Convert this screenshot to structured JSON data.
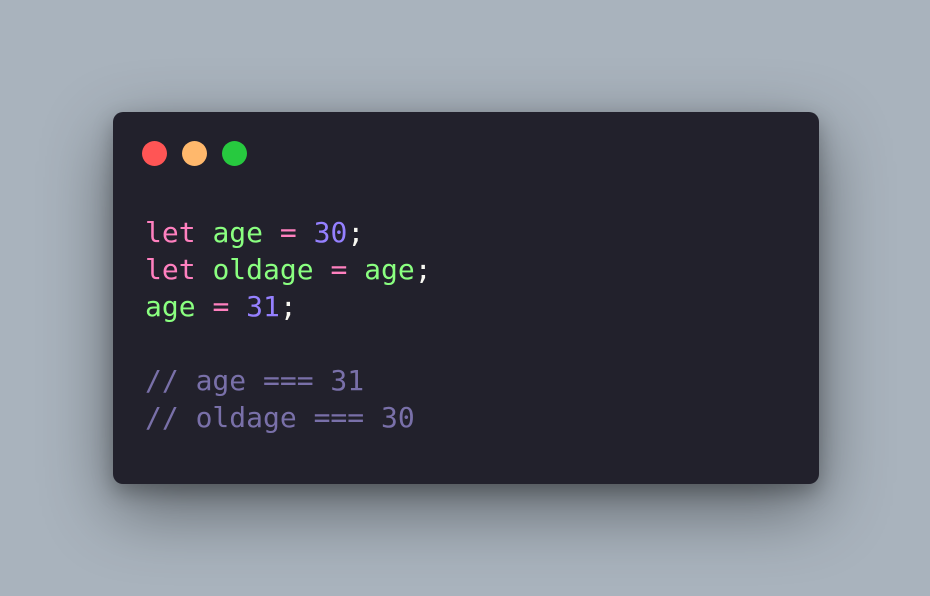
{
  "window": {
    "controls": [
      {
        "name": "close",
        "color": "#ff5555"
      },
      {
        "name": "minimize",
        "color": "#ffb86c"
      },
      {
        "name": "maximize",
        "color": "#27c93f"
      }
    ]
  },
  "code": {
    "lines": [
      [
        {
          "t": "let",
          "c": "kw"
        },
        {
          "t": " "
        },
        {
          "t": "age",
          "c": "var"
        },
        {
          "t": " "
        },
        {
          "t": "=",
          "c": "op"
        },
        {
          "t": " "
        },
        {
          "t": "30",
          "c": "num"
        },
        {
          "t": ";",
          "c": "punc"
        }
      ],
      [
        {
          "t": "let",
          "c": "kw"
        },
        {
          "t": " "
        },
        {
          "t": "oldage",
          "c": "var"
        },
        {
          "t": " "
        },
        {
          "t": "=",
          "c": "op"
        },
        {
          "t": " "
        },
        {
          "t": "age",
          "c": "var"
        },
        {
          "t": ";",
          "c": "punc"
        }
      ],
      [
        {
          "t": "age",
          "c": "var"
        },
        {
          "t": " "
        },
        {
          "t": "=",
          "c": "op"
        },
        {
          "t": " "
        },
        {
          "t": "31",
          "c": "num"
        },
        {
          "t": ";",
          "c": "punc"
        }
      ],
      [],
      [
        {
          "t": "// age === 31",
          "c": "comment"
        }
      ],
      [
        {
          "t": "// oldage === 30",
          "c": "comment"
        }
      ]
    ]
  }
}
